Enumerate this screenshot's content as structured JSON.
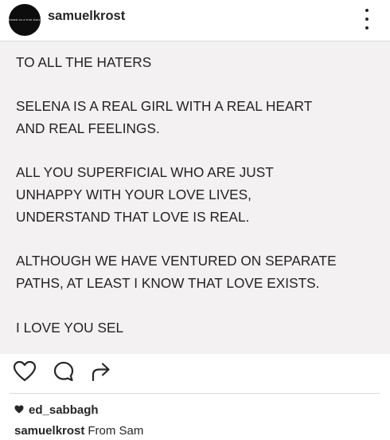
{
  "header": {
    "avatar_text": "based on a true story",
    "username": "samuelkrost"
  },
  "post": {
    "lines": [
      "TO ALL THE HATERS",
      "SELENA IS A REAL GIRL WITH A REAL HEART",
      "AND REAL FEELINGS.",
      "ALL YOU SUPERFICIAL WHO ARE JUST",
      "UNHAPPY WITH YOUR LOVE LIVES,",
      "UNDERSTAND THAT LOVE IS REAL.",
      "ALTHOUGH WE HAVE VENTURED ON SEPARATE",
      "PATHS, AT LEAST I KNOW THAT LOVE EXISTS.",
      "I LOVE YOU SEL"
    ]
  },
  "actions": {
    "icons": [
      "heart-icon",
      "comment-icon",
      "share-icon"
    ]
  },
  "likes": {
    "liked_by": "ed_sabbagh"
  },
  "caption": {
    "username": "samuelkrost",
    "text": "From Sam"
  },
  "colors": {
    "post_background": "#f3f1f2",
    "text": "#262626",
    "divider": "#dbdbdb"
  }
}
